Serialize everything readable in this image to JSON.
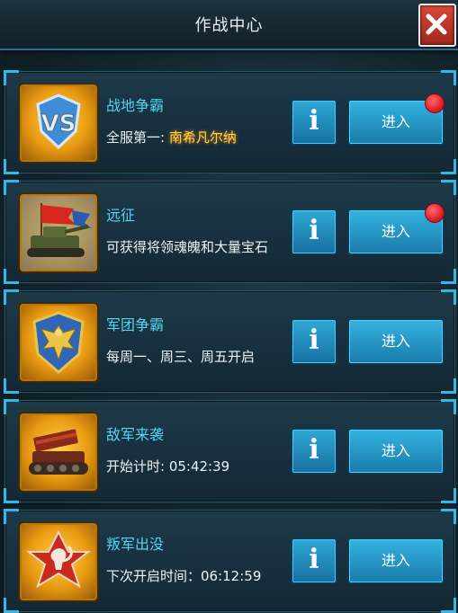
{
  "header": {
    "title": "作战中心",
    "close_icon": "close-icon"
  },
  "cards": [
    {
      "name": "战地争霸",
      "desc_prefix": "全服第一: ",
      "desc_highlight": "南希凡尔纳",
      "icon": "vs-icon",
      "info_label": "i",
      "enter_label": "进入",
      "notification": true
    },
    {
      "name": "远征",
      "desc": "可获得将领魂魄和大量宝石",
      "icon": "tank-flag-icon",
      "info_label": "i",
      "enter_label": "进入",
      "notification": true
    },
    {
      "name": "军团争霸",
      "desc": "每周一、周三、周五开启",
      "icon": "eagle-shield-icon",
      "info_label": "i",
      "enter_label": "进入",
      "notification": false
    },
    {
      "name": "敌军来袭",
      "desc": "开始计时: 05:42:39",
      "icon": "rocket-tank-icon",
      "info_label": "i",
      "enter_label": "进入",
      "notification": false
    },
    {
      "name": "叛军出没",
      "desc": "下次开启时间：06:12:59",
      "icon": "scorpion-star-icon",
      "info_label": "i",
      "enter_label": "进入",
      "notification": false
    }
  ],
  "colors": {
    "accent": "#52d6f2",
    "highlight": "#ffd84a",
    "notification": "#d9141e"
  }
}
